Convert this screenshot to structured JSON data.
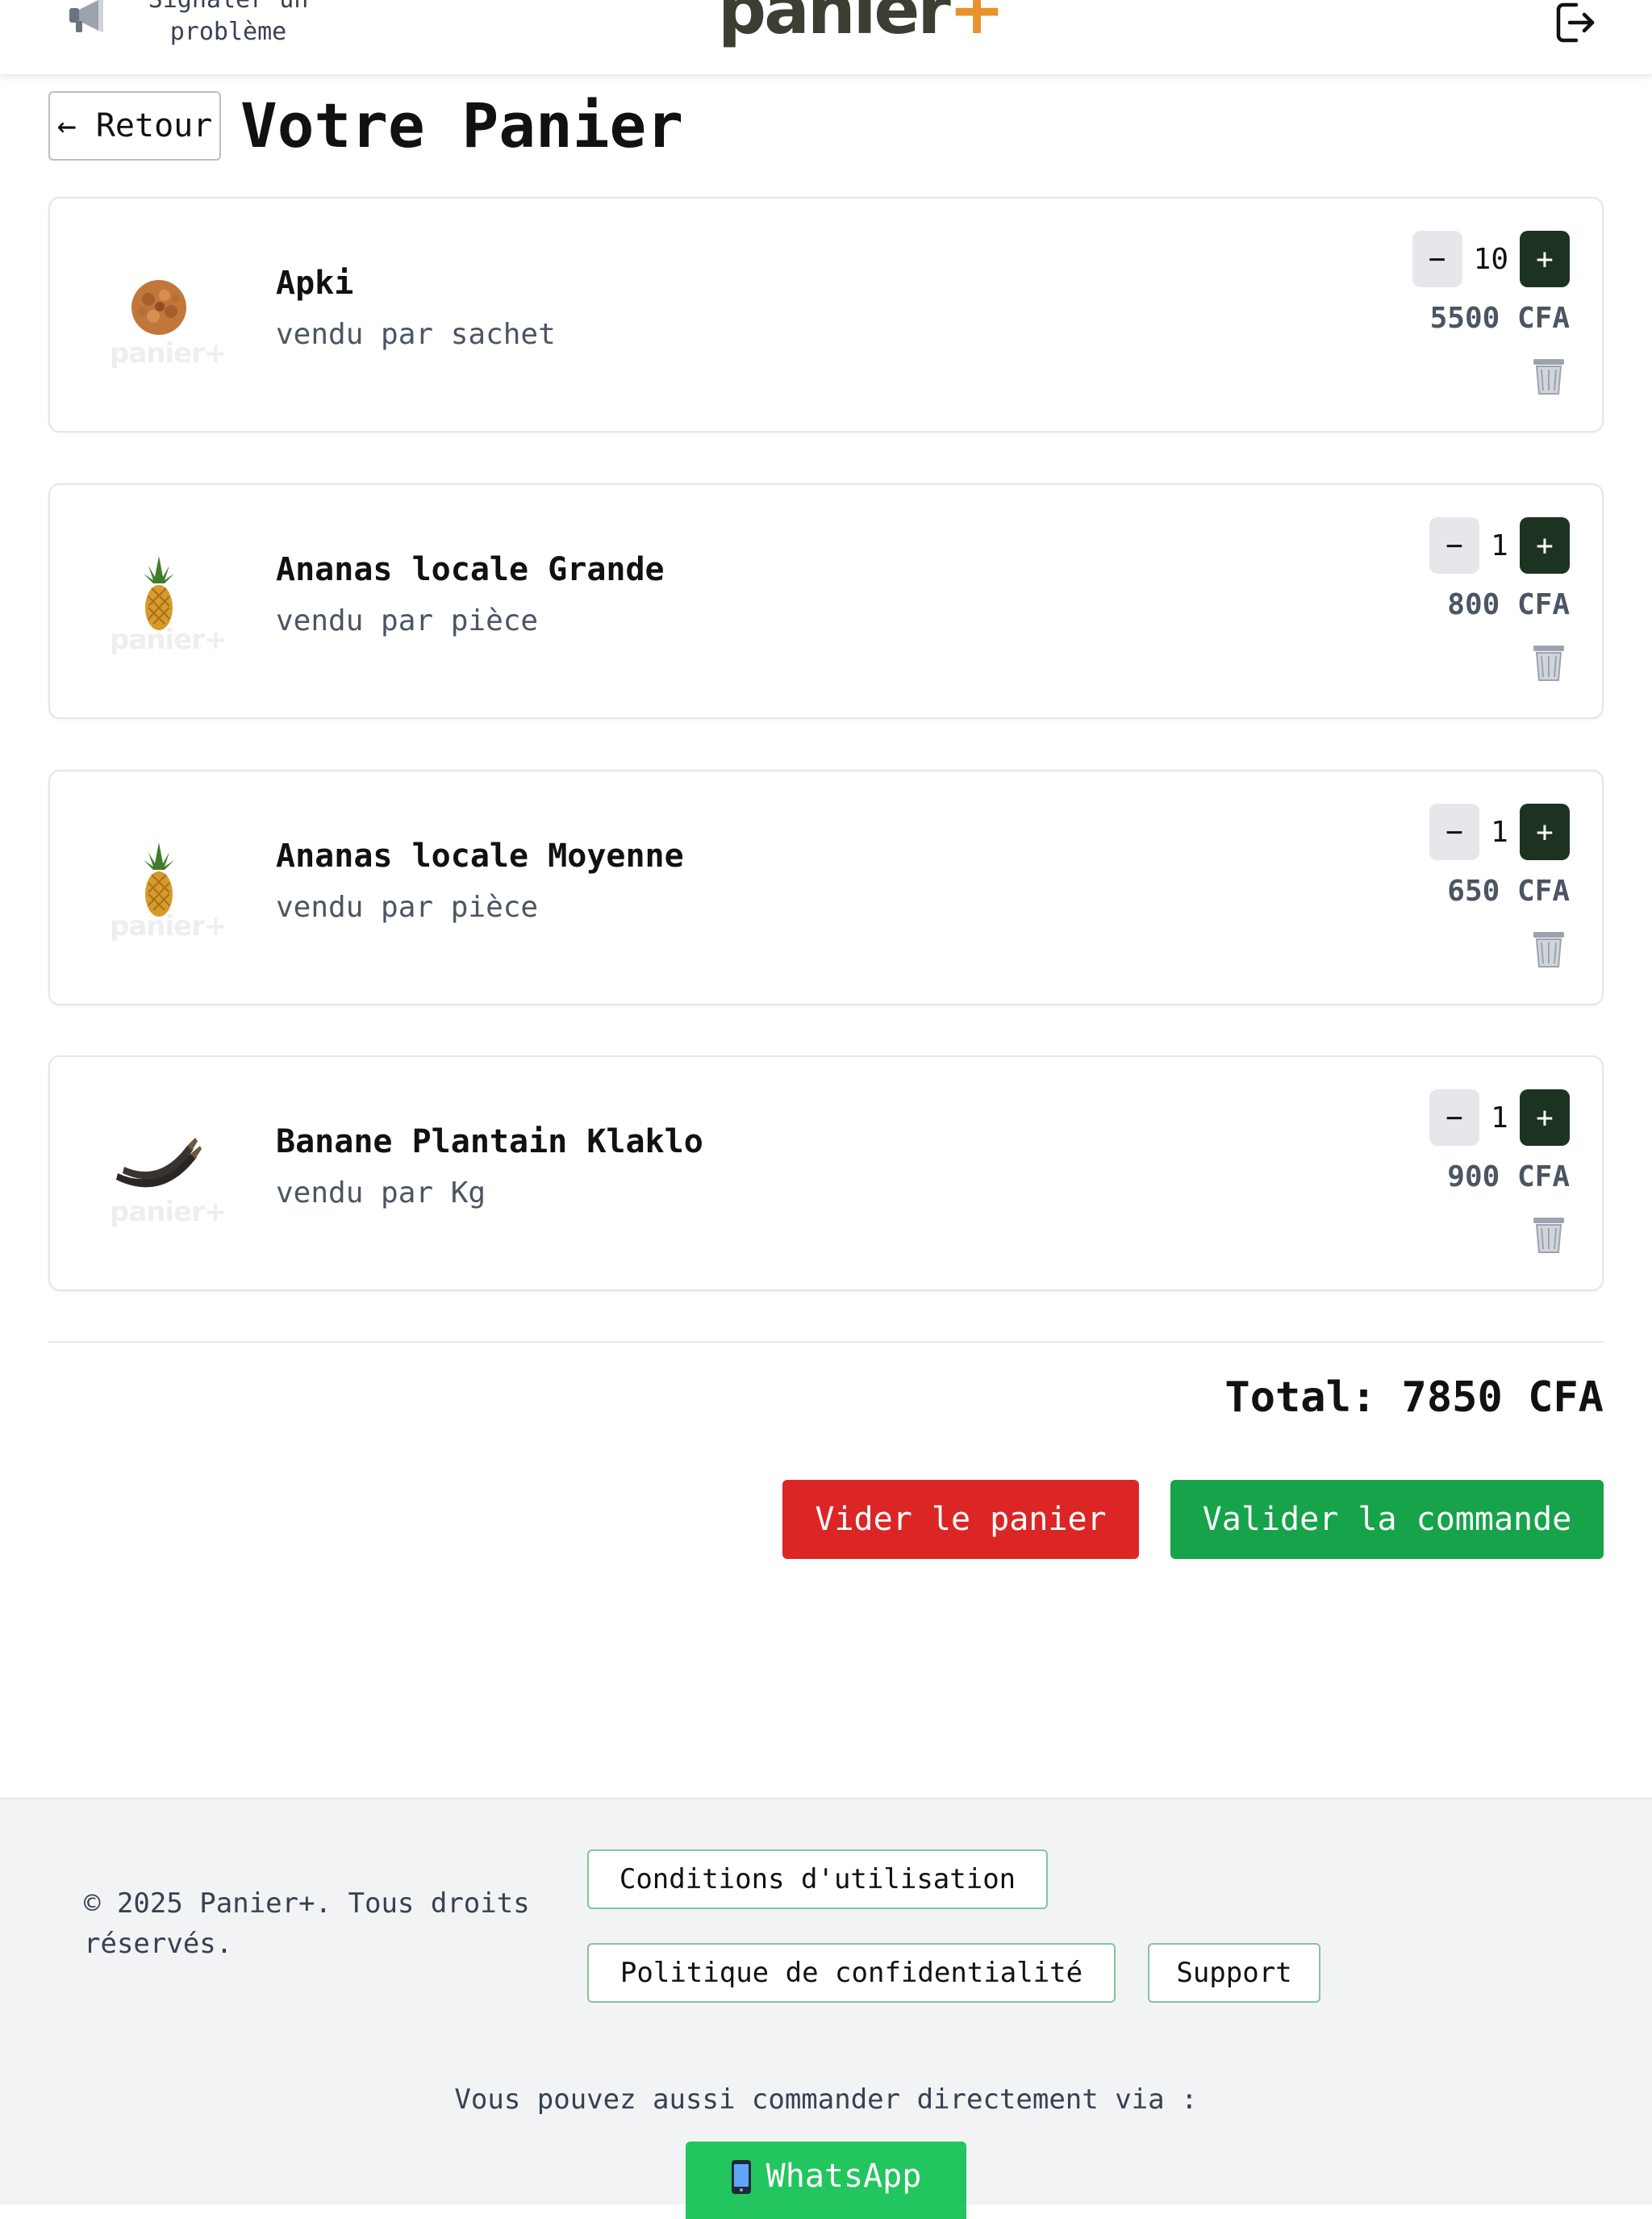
{
  "header": {
    "report_label": "Signaler un problème",
    "logo_part1": "panier",
    "logo_part2": "+",
    "icons": {
      "report": "megaphone-icon",
      "logout": "logout-icon"
    }
  },
  "page": {
    "back_label": "← Retour",
    "title": "Votre Panier"
  },
  "cart": {
    "items": [
      {
        "name": "Apki",
        "unit": "vendu par sachet",
        "quantity": "10",
        "price": "5500 CFA",
        "image": "apki-image",
        "watermark": "panier+"
      },
      {
        "name": "Ananas locale Grande",
        "unit": "vendu par pièce",
        "quantity": "1",
        "price": "800 CFA",
        "image": "pineapple-image",
        "watermark": "panier+"
      },
      {
        "name": "Ananas locale Moyenne",
        "unit": "vendu par pièce",
        "quantity": "1",
        "price": "650 CFA",
        "image": "pineapple-image",
        "watermark": "panier+"
      },
      {
        "name": "Banane Plantain Klaklo",
        "unit": "vendu par Kg",
        "quantity": "1",
        "price": "900 CFA",
        "image": "plantain-image",
        "watermark": "panier+"
      }
    ],
    "minus_label": "−",
    "plus_label": "+",
    "total_label": "Total: 7850 CFA",
    "clear_label": "Vider le panier",
    "validate_label": "Valider la commande"
  },
  "footer": {
    "copyright": "© 2025 Panier+. Tous droits réservés.",
    "links": {
      "terms": "Conditions d'utilisation",
      "privacy": "Politique de confidentialité",
      "support": "Support"
    },
    "order_via": "Vous pouvez aussi commander directement via :",
    "whatsapp_label": "WhatsApp"
  },
  "colors": {
    "logo_dark": "#3d3d33",
    "logo_orange": "#e8922b",
    "plus_button": "#1d3322",
    "clear_button": "#dc2626",
    "validate_button": "#16a34a",
    "whatsapp_button": "#22c55e"
  }
}
